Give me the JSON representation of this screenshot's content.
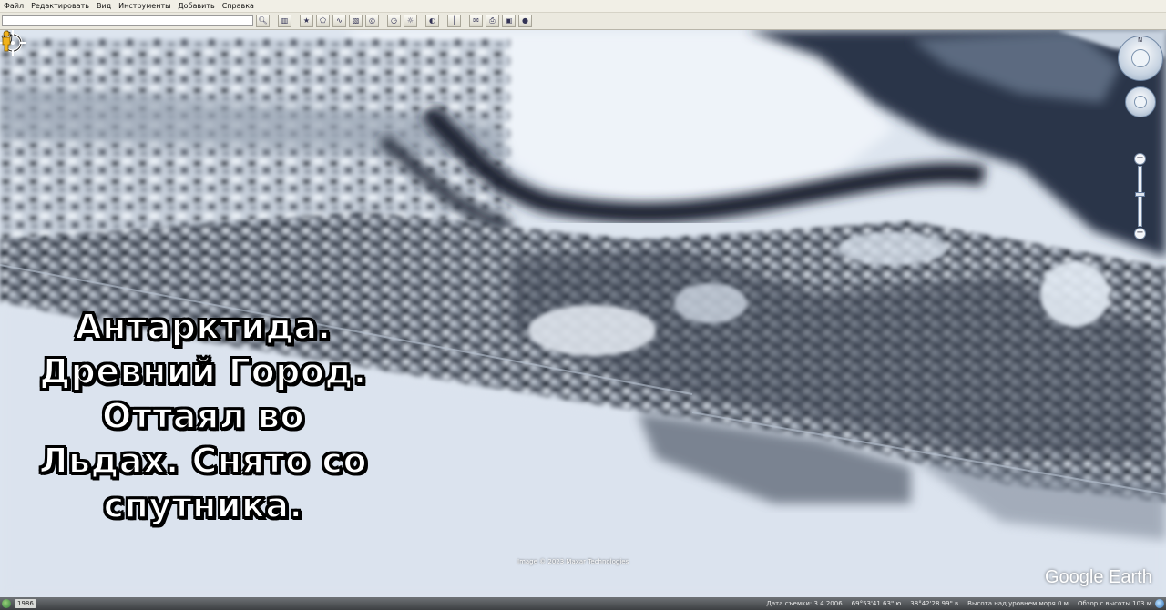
{
  "menu": {
    "items": [
      "Файл",
      "Редактировать",
      "Вид",
      "Инструменты",
      "Добавить",
      "Справка"
    ]
  },
  "toolbar": {
    "search_value": "",
    "buttons": [
      {
        "name": "search-button",
        "icon": "magnifier-icon"
      },
      {
        "name": "sidebar-toggle-button",
        "icon": "sidebar-icon"
      },
      {
        "name": "add-placemark-button",
        "icon": "placemark-icon"
      },
      {
        "name": "add-polygon-button",
        "icon": "polygon-icon"
      },
      {
        "name": "add-path-button",
        "icon": "path-icon"
      },
      {
        "name": "add-overlay-button",
        "icon": "overlay-icon"
      },
      {
        "name": "record-tour-button",
        "icon": "tour-icon"
      },
      {
        "name": "historical-imagery-button",
        "icon": "clock-icon"
      },
      {
        "name": "sunlight-button",
        "icon": "sun-icon"
      },
      {
        "name": "planets-button",
        "icon": "planet-icon"
      },
      {
        "name": "ruler-button",
        "icon": "ruler-icon"
      },
      {
        "name": "email-button",
        "icon": "envelope-icon"
      },
      {
        "name": "print-button",
        "icon": "printer-icon"
      },
      {
        "name": "save-image-button",
        "icon": "image-icon"
      },
      {
        "name": "view-in-maps-button",
        "icon": "globe-icon"
      }
    ]
  },
  "map": {
    "caption_lines": [
      "Антарктида.",
      "Древний Город.",
      "Оттаял во",
      "Льдах. Снято со",
      "спутника."
    ],
    "imagery_credit": "Image © 2023 Maxar Technologies",
    "logo": "Google Earth",
    "north_label": "N"
  },
  "statusbar": {
    "year": "1986",
    "imagery_date": "Дата съемки: 3.4.2006",
    "latitude": "69°53'41.63\" ю",
    "longitude": "38°42'28.99\" в",
    "elevation": "Высота над уровнем моря   0 м",
    "eye_alt": "Обзор с высоты   103 м"
  },
  "colors": {
    "snow": "#e6edf6",
    "shadow": "#2b3340",
    "water": "#2a3648",
    "menubar": "#f1efe6",
    "statusbar": "#4a4e52"
  }
}
